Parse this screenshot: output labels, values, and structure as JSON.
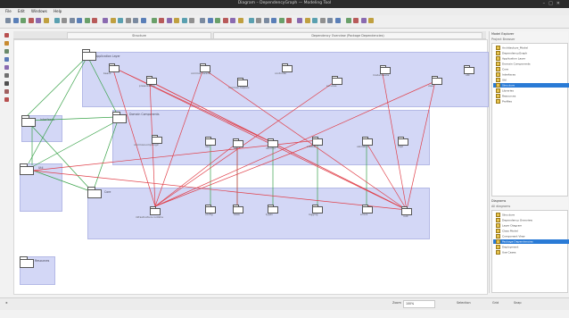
{
  "window": {
    "title": "Diagram – DependencyGraph — Modeling Tool"
  },
  "menu": [
    "File",
    "Edit",
    "Windows",
    "Help"
  ],
  "tabs": [
    {
      "label": "Structure"
    },
    {
      "label": "Dependency Overview (Package Dependencies)"
    }
  ],
  "packages": {
    "top": "Application Layer",
    "mid": "Domain Components",
    "bottom": "Core",
    "left_a": "Interfaces",
    "left_b": "Util",
    "lone": "Resources"
  },
  "nodes": {
    "top_row": [
      "beans",
      "presentation",
      "common.events",
      "common.helpers",
      "controller",
      "services",
      "model.beans",
      "view",
      "util"
    ],
    "mid_row": [
      "commons.impl.logic",
      "dao",
      "api",
      "db.impl",
      "entities",
      "validation",
      "impl"
    ],
    "bottom_row": [
      "infrastructure.runtime",
      "config",
      "base",
      "types",
      "logging",
      "errors",
      "root"
    ]
  },
  "model_browser": {
    "title": "Model Explorer",
    "subtitle": "Project Browser",
    "items": [
      "Architecture_Model",
      "DependencyGraph",
      "Application Layer",
      "Domain Components",
      "Core",
      "Interfaces",
      "Util",
      "Structure",
      "Libraries",
      "Resources",
      "Profiles"
    ],
    "selected_index": 7
  },
  "diagram_list": {
    "title": "Diagrams",
    "subtitle": "All diagrams",
    "items": [
      "Structure",
      "Dependency Overview",
      "Layer Diagram",
      "Class Model",
      "Component View",
      "Package Dependencies",
      "Deployment",
      "Use Cases"
    ],
    "selected_index": 5
  },
  "status": {
    "zoom_label": "Zoom",
    "zoom_value": "100%",
    "mode_label": "Selection",
    "grid_label": "Grid",
    "snap_label": "Snap"
  },
  "colors": {
    "package_fill": "#d3d7f6",
    "dep_red": "#e0404a",
    "dep_green": "#3aa34a",
    "selection": "#2a7bd6"
  }
}
